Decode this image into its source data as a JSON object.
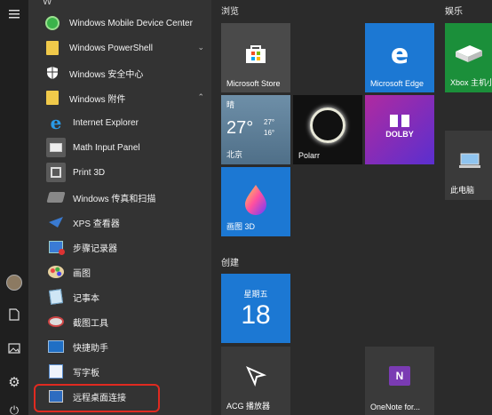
{
  "rail": {
    "menu_icon": "hamburger-icon",
    "items": [
      {
        "name": "user-avatar",
        "glyph": "☺"
      },
      {
        "name": "documents-icon",
        "glyph": "🗋"
      },
      {
        "name": "pictures-icon",
        "glyph": "🖼"
      },
      {
        "name": "settings-icon",
        "glyph": "⚙"
      },
      {
        "name": "power-icon",
        "glyph": "⏻"
      }
    ]
  },
  "applist": {
    "letter": "W",
    "apps": [
      {
        "label": "Windows Mobile Device Center",
        "icon": "mobile-device-center-icon",
        "color": "#3bb34a"
      },
      {
        "label": "Windows PowerShell",
        "icon": "folder-icon",
        "color": "#f0c94a",
        "chevron": "⌄"
      },
      {
        "label": "Windows 安全中心",
        "icon": "shield-icon",
        "color": "#ffffff"
      },
      {
        "label": "Windows 附件",
        "icon": "folder-icon",
        "color": "#f0c94a",
        "chevron": "⌃"
      },
      {
        "label": "Internet Explorer",
        "icon": "internet-explorer-icon",
        "color": "#1f8ad6",
        "sub": true
      },
      {
        "label": "Math Input Panel",
        "icon": "math-input-icon",
        "color": "#5a5a5a",
        "sub": true
      },
      {
        "label": "Print 3D",
        "icon": "print-3d-icon",
        "color": "#5a5a5a",
        "sub": true
      },
      {
        "label": "Windows 传真和扫描",
        "icon": "fax-scan-icon",
        "color": "#6a6a6a",
        "sub": true
      },
      {
        "label": "XPS 查看器",
        "icon": "xps-viewer-icon",
        "color": "#2a6db5",
        "sub": true
      },
      {
        "label": "步骤记录器",
        "icon": "steps-recorder-icon",
        "color": "#3a7bd5",
        "sub": true
      },
      {
        "label": "画图",
        "icon": "paint-icon",
        "color": "#d9a441",
        "sub": true
      },
      {
        "label": "记事本",
        "icon": "notepad-icon",
        "color": "#7fb8e0",
        "sub": true
      },
      {
        "label": "截图工具",
        "icon": "snipping-tool-icon",
        "color": "#c44",
        "sub": true
      },
      {
        "label": "快捷助手",
        "icon": "quick-assist-icon",
        "color": "#1f6fc5",
        "sub": true
      },
      {
        "label": "写字板",
        "icon": "wordpad-icon",
        "color": "#5b8fd0",
        "sub": true
      },
      {
        "label": "远程桌面连接",
        "icon": "remote-desktop-icon",
        "color": "#2d6cc0",
        "sub": true
      }
    ]
  },
  "groups": {
    "browse": "浏览",
    "entertainment": "娱乐",
    "create": "创建"
  },
  "tiles": {
    "store": {
      "label": "Microsoft Store",
      "bg": "#4a4a4a"
    },
    "edge": {
      "label": "Microsoft Edge",
      "bg": "#1c78d3"
    },
    "xbox": {
      "label": "Xbox 主机小",
      "bg": "#1b8f3a"
    },
    "weather": {
      "condition": "晴",
      "temp": "27°",
      "high": "27°",
      "low": "16°",
      "city": "北京",
      "bg": "#6e8fa8"
    },
    "polarr": {
      "label": "Polarr",
      "bg": "#111111"
    },
    "dolby": {
      "label": "DOLBY",
      "bg": "#7a2bbf"
    },
    "thispc": {
      "label": "此电脑",
      "bg": "#3a3a3a"
    },
    "paint3d": {
      "label": "画图 3D",
      "bg": "#1c78d3"
    },
    "calendar": {
      "weekday": "星期五",
      "day": "18",
      "bg": "#1c78d3"
    },
    "acg": {
      "label": "ACG 播放器",
      "bg": "#3a3a3a"
    },
    "onenote": {
      "label": "OneNote for...",
      "bg": "#3a3a3a"
    }
  }
}
